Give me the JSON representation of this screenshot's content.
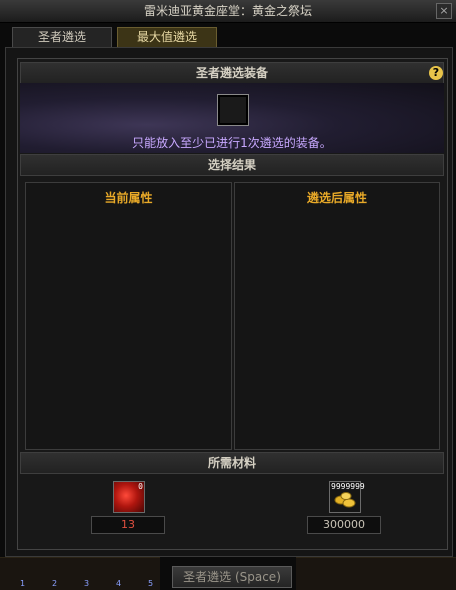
{
  "window": {
    "title": "雷米迪亚黄金座堂：黄金之祭坛",
    "close_glyph": "×"
  },
  "tabs": [
    {
      "label": "圣者遴选"
    },
    {
      "label": "最大值遴选"
    }
  ],
  "equipment": {
    "header": "圣者遴选装备",
    "help_glyph": "?",
    "notice": "只能放入至少已进行1次遴选的装备。"
  },
  "result": {
    "header": "选择结果",
    "current_label": "当前属性",
    "after_label": "遴选后属性"
  },
  "materials": {
    "header": "所需材料",
    "items": [
      {
        "name": "red-gem",
        "badge": "0",
        "qty": "13",
        "qty_color": "#e05040"
      },
      {
        "name": "gold",
        "badge": "9999999",
        "qty": "300000",
        "qty_color": "#c9c3b6"
      }
    ]
  },
  "action": {
    "label": "圣者遴选 (Space)"
  },
  "hotkeys": [
    "1",
    "2",
    "3",
    "4",
    "5"
  ]
}
